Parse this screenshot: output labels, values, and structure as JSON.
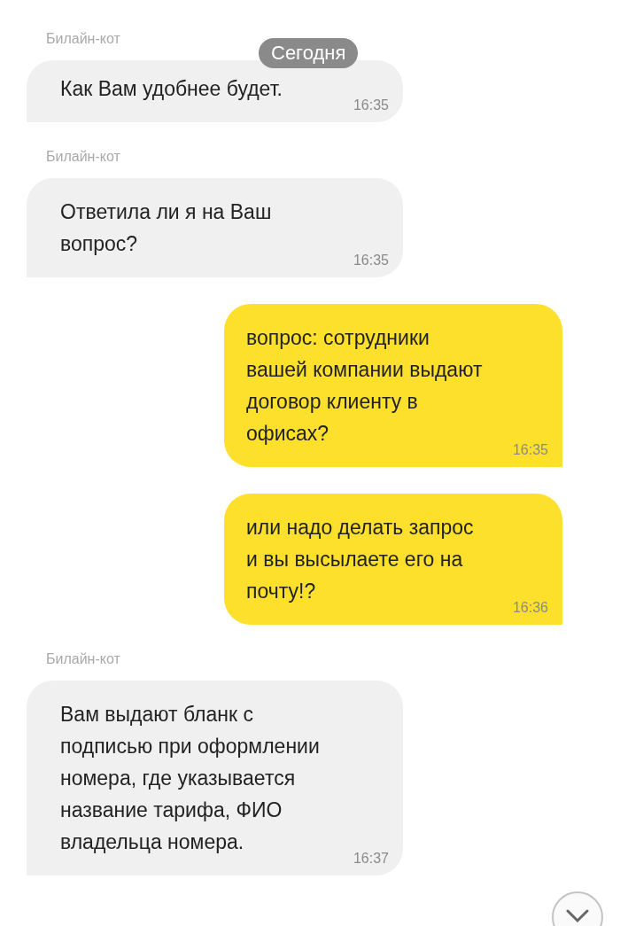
{
  "date_chip": "Сегодня",
  "messages": [
    {
      "kind": "incoming",
      "sender": "Билайн-кот",
      "text": "Как Вам удобнее будет.",
      "time": "16:35"
    },
    {
      "kind": "incoming",
      "sender": "Билайн-кот",
      "text": "Ответила ли я на Ваш\nвопрос?",
      "time": "16:35"
    },
    {
      "kind": "outgoing",
      "text": "вопрос: сотрудники\nвашей компании выдают\nдоговор клиенту в\nофисах?",
      "time": "16:35"
    },
    {
      "kind": "outgoing",
      "text": "или надо делать запрос\nи вы высылаете его на\nпочту!?",
      "time": "16:36"
    },
    {
      "kind": "incoming",
      "sender": "Билайн-кот",
      "text": "Вам выдают бланк с\nподписью при оформлении\nномера, где указывается\nназвание тарифа, ФИО\nвладельца номера.",
      "time": "16:37"
    }
  ]
}
